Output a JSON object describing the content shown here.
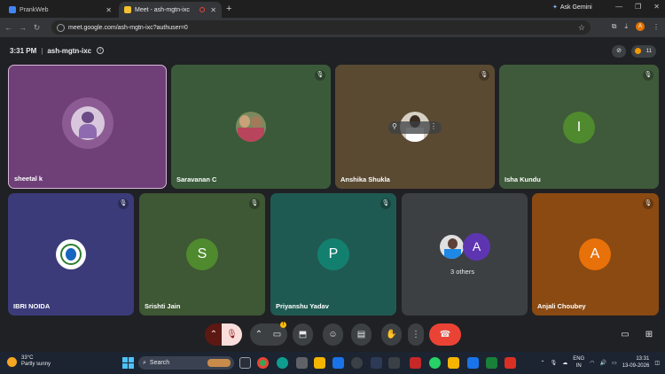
{
  "browser": {
    "tabs": [
      {
        "title": "PrankWeb",
        "active": false
      },
      {
        "title": "Meet - ash-mgtn-ixc",
        "active": true
      }
    ],
    "new_tab": "+",
    "ask_gemini": "Ask Gemini",
    "url": "meet.google.com/ash-mgtn-ixc?authuser=0",
    "profile_initial": "A"
  },
  "meet": {
    "time": "3:31 PM",
    "meeting_code": "ash-mgtn-ixc",
    "participants_count": "11",
    "tiles": [
      {
        "name": "sheetal k",
        "type": "photo",
        "bg": "#6f3f78",
        "muted": false,
        "speaking": true
      },
      {
        "name": "Saravanan C",
        "type": "photo",
        "bg": "#3b5a3a",
        "muted": true
      },
      {
        "name": "Anshika Shukla",
        "type": "photo",
        "bg": "#5b4a32",
        "muted": true
      },
      {
        "name": "Isha Kundu",
        "type": "letter",
        "letter": "I",
        "bg": "#3f5a3b",
        "avatar_color": "#4f8a2e",
        "muted": true
      },
      {
        "name": "IBRI NOIDA",
        "type": "photo",
        "bg": "#3b3b7a",
        "muted": true
      },
      {
        "name": "Srishti Jain",
        "type": "letter",
        "letter": "S",
        "bg": "#3e5734",
        "avatar_color": "#4f8a2e",
        "muted": true
      },
      {
        "name": "Priyanshu Yadav",
        "type": "letter",
        "letter": "P",
        "bg": "#1f5a52",
        "avatar_color": "#13806f",
        "muted": true
      },
      {
        "name": "",
        "type": "others",
        "letter": "A",
        "others_label": "3 others",
        "bg": "#3c4043",
        "avatar_color": "#5e35b1"
      },
      {
        "name": "Anjali Choubey",
        "type": "letter",
        "letter": "A",
        "bg": "#8a4a12",
        "avatar_color": "#e8710a",
        "muted": true
      }
    ]
  },
  "taskbar": {
    "temperature": "33°C",
    "weather_desc": "Partly sunny",
    "search_placeholder": "Search",
    "lang_line1": "ENG",
    "lang_line2": "IN",
    "clock_time": "13:31",
    "clock_date": "13-09-2026"
  }
}
